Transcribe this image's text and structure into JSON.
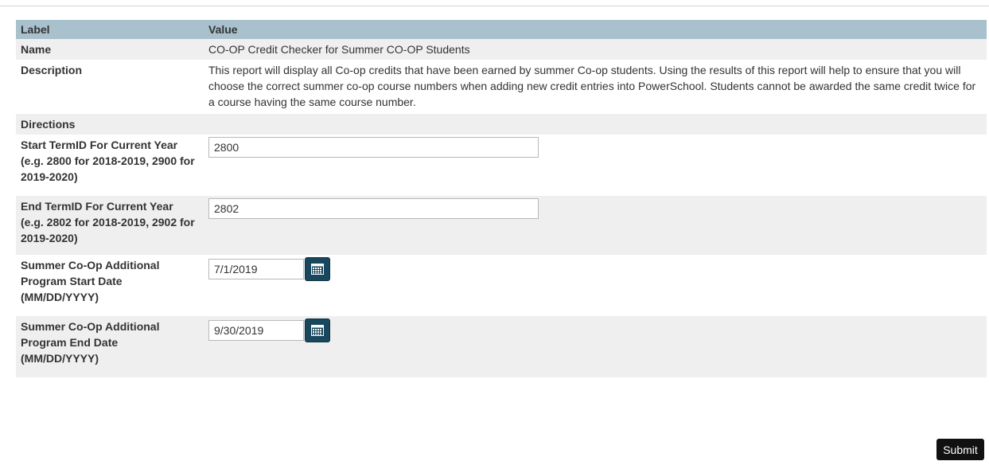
{
  "table": {
    "header": {
      "label": "Label",
      "value": "Value"
    },
    "name": {
      "label": "Name",
      "value": "CO-OP Credit Checker for Summer CO-OP Students"
    },
    "description": {
      "label": "Description",
      "value": "This report will display all Co-op credits that have been earned by summer Co-op students. Using the results of this report will help to ensure that you will choose the correct summer co-op course numbers when adding new credit entries into PowerSchool. Students cannot be awarded the same credit twice for a course having the same course number."
    },
    "directions": {
      "label": "Directions"
    },
    "start_term": {
      "label": "Start TermID For Current Year (e.g. 2800 for 2018-2019, 2900 for 2019-2020)",
      "value": "2800"
    },
    "end_term": {
      "label": "End TermID For Current Year (e.g. 2802 for 2018-2019, 2902 for 2019-2020)",
      "value": "2802"
    },
    "start_date": {
      "label": "Summer Co-Op Additional Program Start Date (MM/DD/YYYY)",
      "value": "7/1/2019",
      "icon": "calendar-icon"
    },
    "end_date": {
      "label": "Summer Co-Op Additional Program End Date (MM/DD/YYYY)",
      "value": "9/30/2019",
      "icon": "calendar-icon"
    }
  },
  "submit_label": "Submit",
  "colors": {
    "header_bg": "#a8c1cc",
    "row_alt_bg": "#efefef",
    "calendar_button": "#18475e",
    "submit_bg": "#111111"
  }
}
